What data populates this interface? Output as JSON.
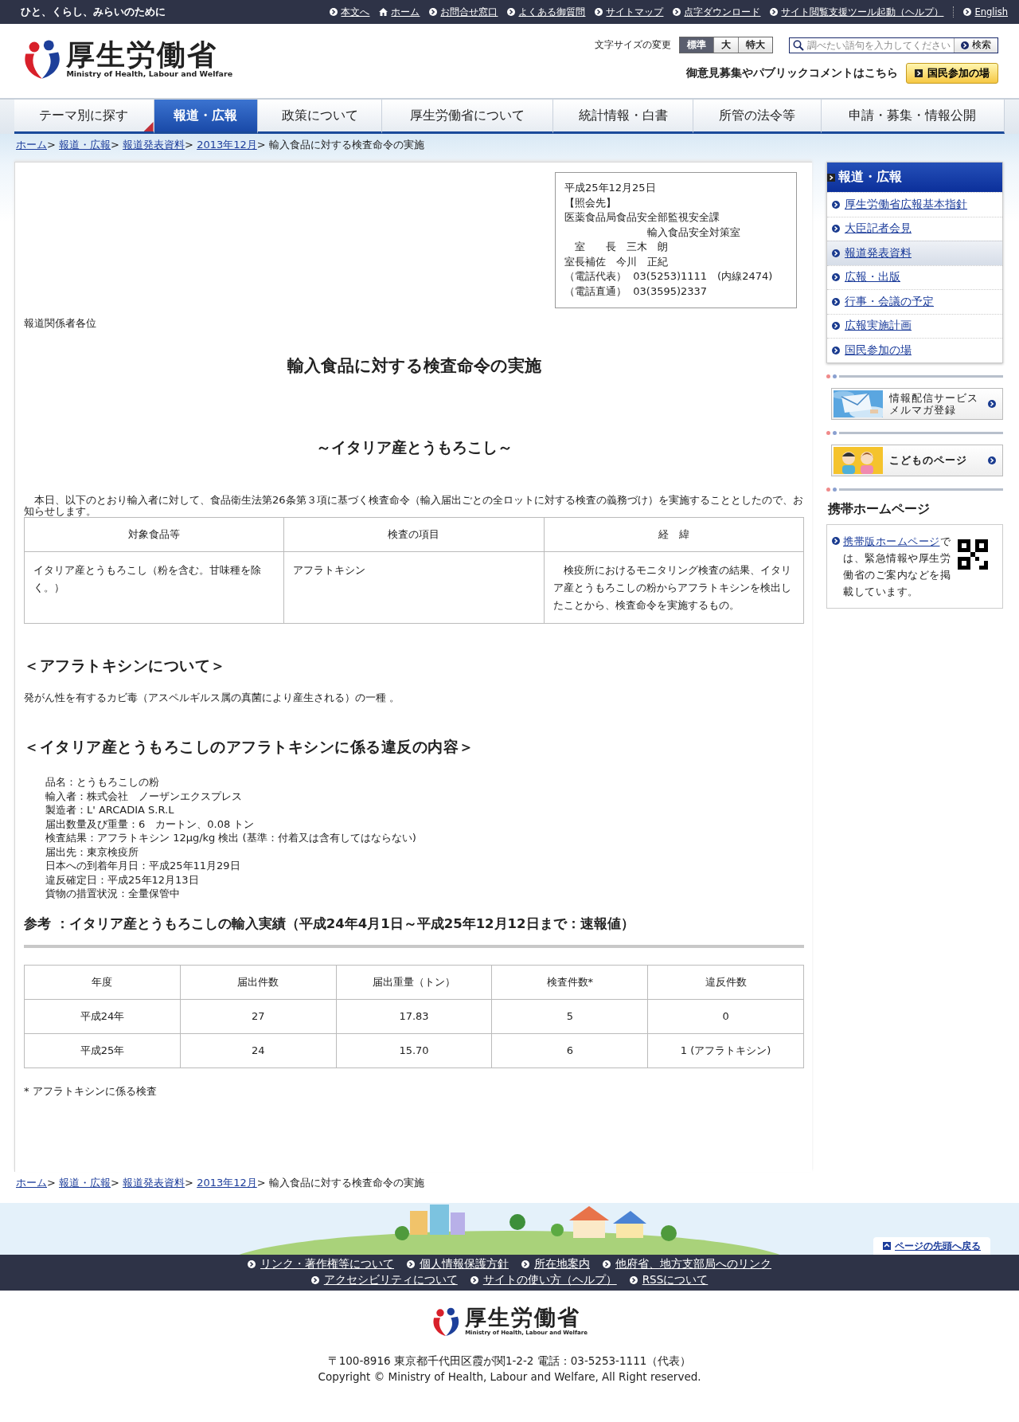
{
  "top_bar": {
    "tagline": "ひと、くらし、みらいのために",
    "links": [
      {
        "label": "本文へ",
        "kind": "link"
      },
      {
        "label": "ホーム",
        "kind": "home"
      },
      {
        "label": "お問合せ窓口",
        "kind": "link"
      },
      {
        "label": "よくある御質問",
        "kind": "link"
      },
      {
        "label": "サイトマップ",
        "kind": "link"
      },
      {
        "label": "点字ダウンロード",
        "kind": "link"
      },
      {
        "label": "サイト閲覧支援ツール起動（ヘルプ）",
        "kind": "link"
      },
      {
        "label": "English",
        "kind": "link"
      }
    ]
  },
  "header": {
    "logo_name": "厚生労働省",
    "logo_subtitle": "Ministry of Health, Labour and Welfare",
    "font_size_label": "文字サイズの変更",
    "font_sizes": [
      {
        "label": "標準",
        "selected": true
      },
      {
        "label": "大",
        "selected": false
      },
      {
        "label": "特大",
        "selected": false
      }
    ],
    "search": {
      "placeholder": "調べたい語句を入力してください",
      "button": "検索"
    },
    "comment_text": "御意見募集やパブリックコメントはこちら",
    "participation_button": "国民参加の場"
  },
  "nav": [
    {
      "label": "テーマ別に探す",
      "selected": false
    },
    {
      "label": "報道・広報",
      "selected": true
    },
    {
      "label": "政策について",
      "selected": false
    },
    {
      "label": "厚生労働省について",
      "selected": false
    },
    {
      "label": "統計情報・白書",
      "selected": false
    },
    {
      "label": "所管の法令等",
      "selected": false
    },
    {
      "label": "申請・募集・情報公開",
      "selected": false
    }
  ],
  "breadcrumb": {
    "links": [
      "ホーム",
      "報道・広報",
      "報道発表資料",
      "2013年12月"
    ],
    "separator": ">",
    "current": "輸入食品に対する検査命令の実施"
  },
  "notice_box": [
    "平成25年12月25日",
    "【照会先】",
    "医薬食品局食品安全部監視安全課",
    "　　　　　　　　輸入食品安全対策室",
    "　室　　長　三木　朗",
    "室長補佐　今川　正紀",
    "（電話代表）  03(5253)1111　(内線2474)",
    "（電話直通）  03(3595)2337"
  ],
  "addressee": "報道関係者各位",
  "title": "輸入食品に対する検査命令の実施",
  "subtitle": "～イタリア産とうもろこし～",
  "intro": "　本日、以下のとおり輸入者に対して、食品衛生法第26条第３項に基づく検査命令（輸入届出ごとの全ロットに対する検査の義務づけ）を実施することとしたので、お知らせします。",
  "order_table": {
    "columns": [
      "対象食品等",
      "検査の項目",
      "経　緯"
    ],
    "rows": [
      [
        "イタリア産とうもろこし（粉を含む。甘味種を除く。）",
        "アフラトキシン",
        "　検疫所におけるモニタリング検査の結果、イタリア産とうもろこしの粉からアフラトキシンを検出したことから、検査命令を実施するもの。"
      ]
    ]
  },
  "aflatoxin_section": {
    "heading": "＜アフラトキシンについて＞",
    "text": "発がん性を有するカビ毒（アスペルギルス属の真菌により産生される）の一種 。"
  },
  "violation_section": {
    "heading": "＜イタリア産とうもろこしのアフラトキシンに係る違反の内容＞",
    "items": [
      "品名：とうもろこしの粉",
      "輸入者：株式会社　ノーザンエクスプレス",
      "製造者：L' ARCADIA S.R.L",
      "届出数量及び重量：6　カートン、0.08 トン",
      "検査結果：アフラトキシン 12μg/kg 検出 (基準：付着又は含有してはならない)",
      "届出先：東京検疫所",
      "日本への到着年月日：平成25年11月29日",
      "違反確定日：平成25年12月13日",
      "貨物の措置状況：全量保管中"
    ]
  },
  "reference_heading": "参考 ：イタリア産とうもろこしの輸入実績（平成24年4月1日～平成25年12月12日まで：速報値）",
  "import_table": {
    "columns": [
      "年度",
      "届出件数",
      "届出重量（トン）",
      "検査件数*",
      "違反件数"
    ],
    "rows": [
      [
        "平成24年",
        "27",
        "17.83",
        "5",
        "0"
      ],
      [
        "平成25年",
        "24",
        "15.70",
        "6",
        "1 (アフラトキシン)"
      ]
    ]
  },
  "footnote": "* アフラトキシンに係る検査",
  "sidebar": {
    "title": "報道・広報",
    "items": [
      {
        "label": "厚生労働省広報基本指針",
        "selected": false
      },
      {
        "label": "大臣記者会見",
        "selected": false
      },
      {
        "label": "報道発表資料",
        "selected": true
      },
      {
        "label": "広報・出版",
        "selected": false
      },
      {
        "label": "行事・会議の予定",
        "selected": false
      },
      {
        "label": "広報実施計画",
        "selected": false
      },
      {
        "label": "国民参加の場",
        "selected": false
      }
    ],
    "banners": [
      {
        "kind": "mail",
        "lines": [
          "情報配信サービス",
          "メルマガ登録"
        ]
      },
      {
        "kind": "kids",
        "lines": [
          "こどものページ"
        ]
      }
    ],
    "mobile": {
      "title": "携帯ホームページ",
      "link": "携帯版ホームページ",
      "text": "では、緊急情報や厚生労働省のご案内などを掲載しています。"
    }
  },
  "bottom_breadcrumb": {
    "links": [
      "ホーム",
      "報道・広報",
      "報道発表資料",
      "2013年12月"
    ],
    "separator": ">",
    "current": "輸入食品に対する検査命令の実施"
  },
  "page_top": "ページの先頭へ戻る",
  "footer": {
    "link_rows": [
      [
        "リンク・著作権等について",
        "個人情報保護方針",
        "所在地案内",
        "他府省、地方支部局へのリンク"
      ],
      [
        "アクセシビリティについて",
        "サイトの使い方（ヘルプ）",
        "RSSについて"
      ]
    ],
    "logo_name": "厚生労働省",
    "logo_subtitle": "Ministry of Health, Labour and Welfare",
    "address": "〒100-8916 東京都千代田区霞が関1-2-2 電話：03-5253-1111（代表）",
    "copyright": "Copyright © Ministry of Health, Labour and Welfare, All Right reserved."
  }
}
